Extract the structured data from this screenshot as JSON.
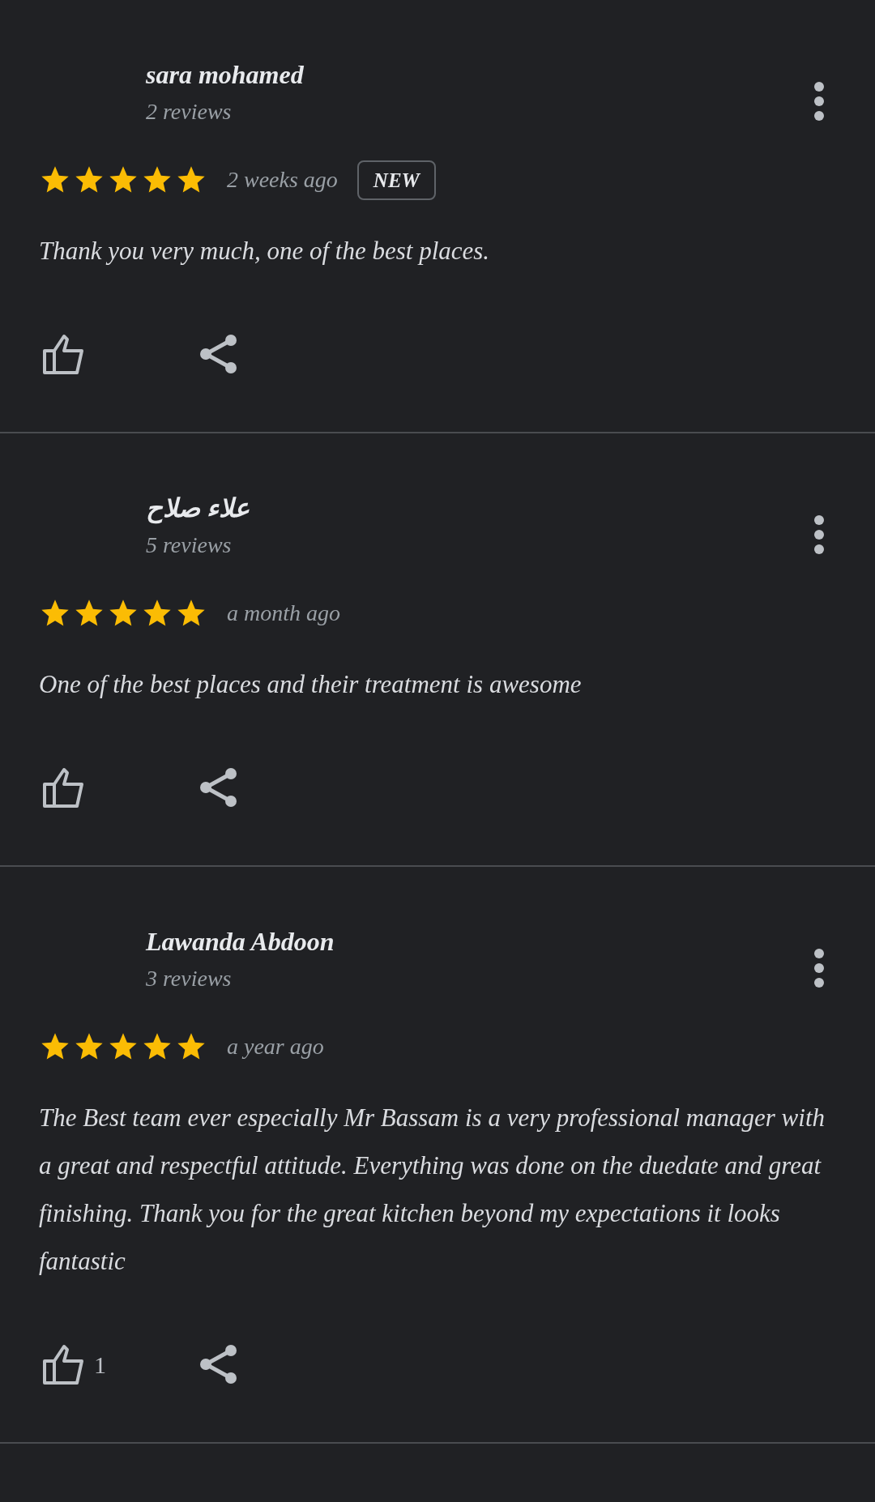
{
  "reviews": [
    {
      "author": "sara mohamed",
      "review_count": "2 reviews",
      "stars": 5,
      "time": "2 weeks ago",
      "badge": "NEW",
      "text": "Thank you very much,  one of the best places."
    },
    {
      "author": "علاء صلاح",
      "review_count": "5 reviews",
      "stars": 5,
      "time": "a month ago",
      "text": "One of the best places and their treatment is awesome"
    },
    {
      "author": "Lawanda Abdoon",
      "review_count": "3 reviews",
      "stars": 5,
      "time": "a year ago",
      "text": "The Best team ever especially Mr Bassam is a very professional manager with a great and respectful attitude. Everything was done on the duedate and great finishing. Thank you for the great kitchen beyond my expectations it looks fantastic",
      "likes": "1"
    }
  ]
}
